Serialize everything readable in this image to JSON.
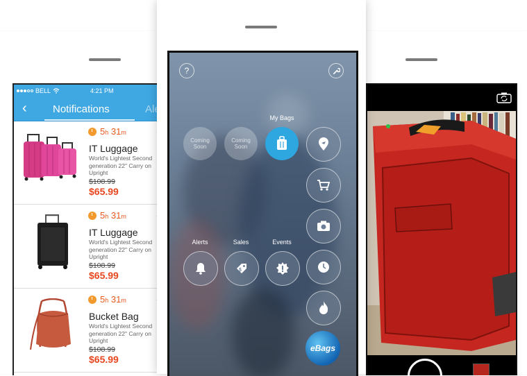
{
  "left_screen": {
    "status": {
      "carrier": "BELL",
      "time": "4:21 PM"
    },
    "nav": {
      "back_icon": "chevron-left-icon",
      "title": "Notifications",
      "next_tab": "Ale"
    },
    "items": [
      {
        "hours": "5",
        "h": "h",
        "minutes": "31",
        "m": "m",
        "name": "IT Luggage",
        "desc_1": "World's Lightest Second",
        "desc_2": "generation 22\" Carry on",
        "desc_3": "Upright",
        "old_price": "$108.99",
        "price": "$65.99"
      },
      {
        "hours": "5",
        "h": "h",
        "minutes": "31",
        "m": "m",
        "name": "IT Luggage",
        "desc_1": "World's Lightest Second",
        "desc_2": "generation 22\" Carry on",
        "desc_3": "Upright",
        "old_price": "$108.99",
        "price": "$65.99"
      },
      {
        "hours": "5",
        "h": "h",
        "minutes": "31",
        "m": "m",
        "name": "Bucket Bag",
        "desc_1": "World's Lightest Second",
        "desc_2": "generation 22\" Carry on",
        "desc_3": "Upright",
        "old_price": "$108.99",
        "price": "$65.99"
      }
    ]
  },
  "center_screen": {
    "help_label": "?",
    "coming_soon_1": "Coming Soon",
    "coming_soon_2": "Coming Soon",
    "my_bags_label": "My Bags",
    "alerts_label": "Alerts",
    "sales_label": "Sales",
    "events_label": "Events",
    "logo_text": "eBags",
    "colors": {
      "accent": "#2ea7e0"
    }
  },
  "colors": {
    "header_blue": "#3fa8e2",
    "price_red": "#e8461f",
    "timer_orange": "#f29a2e"
  }
}
